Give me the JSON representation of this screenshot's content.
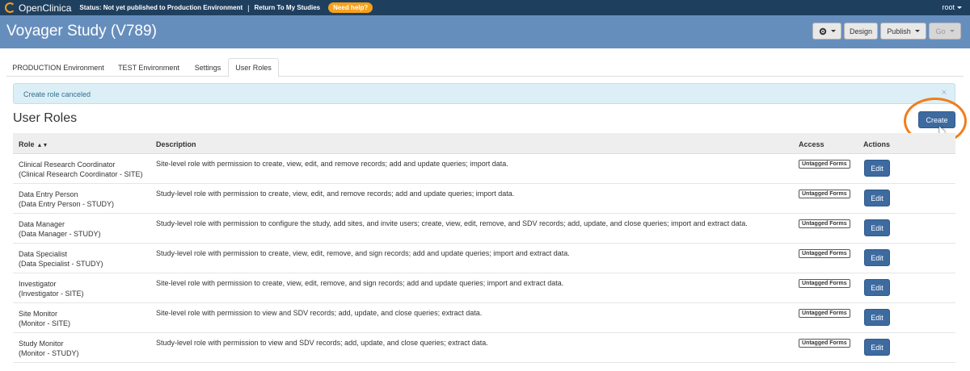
{
  "topbar": {
    "logo_text": "OpenClinica",
    "status": "Status: Not yet published to Production Environment",
    "separator": "|",
    "return_link": "Return To My Studies",
    "help": "Need help?",
    "user": "root"
  },
  "header": {
    "title": "Voyager Study (V789)",
    "buttons": {
      "design": "Design",
      "publish": "Publish",
      "go": "Go"
    }
  },
  "tabs": [
    {
      "label": "PRODUCTION Environment"
    },
    {
      "label": "TEST Environment"
    },
    {
      "label": "Settings"
    },
    {
      "label": "User Roles"
    }
  ],
  "alert": {
    "message": "Create role canceled",
    "close": "×"
  },
  "section_title": "User Roles",
  "create_label": "Create",
  "table": {
    "headers": {
      "role": "Role",
      "description": "Description",
      "access": "Access",
      "actions": "Actions"
    },
    "rows": [
      {
        "role": "Clinical Research Coordinator",
        "role_sub": "(Clinical Research Coordinator - SITE)",
        "description": "Site-level role with permission to create, view, edit, and remove records; add and update queries; import data.",
        "access": "Untagged Forms",
        "action": "Edit"
      },
      {
        "role": "Data Entry Person",
        "role_sub": "(Data Entry Person - STUDY)",
        "description": "Study-level role with permission to create, view, edit, and remove records; add and update queries; import data.",
        "access": "Untagged Forms",
        "action": "Edit"
      },
      {
        "role": "Data Manager",
        "role_sub": "(Data Manager - STUDY)",
        "description": "Study-level role with permission to configure the study, add sites, and invite users; create, view, edit, remove, and SDV records; add, update, and close queries; import and extract data.",
        "access": "Untagged Forms",
        "action": "Edit"
      },
      {
        "role": "Data Specialist",
        "role_sub": "(Data Specialist - STUDY)",
        "description": "Study-level role with permission to create, view, edit, remove, and sign records; add and update queries; import and extract data.",
        "access": "Untagged Forms",
        "action": "Edit"
      },
      {
        "role": "Investigator",
        "role_sub": "(Investigator - SITE)",
        "description": "Site-level role with permission to create, view, edit, remove, and sign records; add and update queries; import and extract data.",
        "access": "Untagged Forms",
        "action": "Edit"
      },
      {
        "role": "Site Monitor",
        "role_sub": "(Monitor - SITE)",
        "description": "Site-level role with permission to view and SDV records; add, update, and close queries; extract data.",
        "access": "Untagged Forms",
        "action": "Edit"
      },
      {
        "role": "Study Monitor",
        "role_sub": "(Monitor - STUDY)",
        "description": "Study-level role with permission to view and SDV records; add, update, and close queries; extract data.",
        "access": "Untagged Forms",
        "action": "Edit"
      }
    ]
  },
  "colors": {
    "topbar": "#1f3f5f",
    "header": "#668ebd",
    "accent_orange": "#f7a11a",
    "primary_button": "#3d6a9f",
    "alert_bg": "#dceff6",
    "highlight_ring": "#f07d1a"
  }
}
